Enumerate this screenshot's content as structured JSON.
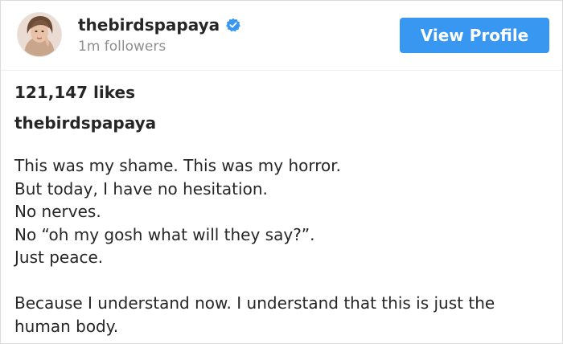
{
  "header": {
    "username": "thebirdspapaya",
    "followers": "1m followers",
    "verified_icon": "verified-badge-icon",
    "view_profile_label": "View Profile",
    "accent_color": "#3897f0"
  },
  "post": {
    "likes": "121,147 likes",
    "caption_username": "thebirdspapaya",
    "caption_lines": [
      "This was my shame. This was my horror.",
      "But today, I have no hesitation.",
      "No nerves.",
      "No “oh my gosh what will they say?”.",
      "Just peace."
    ],
    "caption_paragraph_2": "Because I understand now. I understand that this is just the human body."
  }
}
